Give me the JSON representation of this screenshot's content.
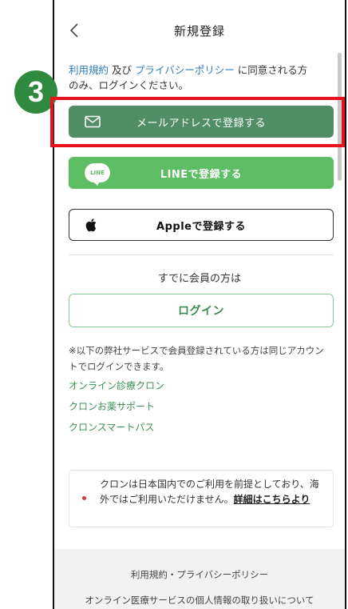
{
  "header": {
    "back_icon": "chevron-left-icon",
    "title": "新規登録"
  },
  "consent": {
    "terms_link": "利用規約",
    "and": " 及び ",
    "privacy_link": "プライバシーポリシー",
    "text": " に同意される方のみ、ログインください。"
  },
  "buttons": {
    "email": {
      "icon": "mail-icon",
      "label": "メールアドレスで登録する"
    },
    "line": {
      "icon": "line-logo-icon",
      "badge": "LINE",
      "label": "LINEで登録する"
    },
    "apple": {
      "icon": "apple-logo-icon",
      "label": "Appleで登録する"
    },
    "login": {
      "label": "ログイン"
    }
  },
  "member_text": "すでに会員の方は",
  "note": "※以下の弊社サービスで会員登録されている方は同じアカウントでログインできます。",
  "services": [
    "オンライン診療クロン",
    "クロンお薬サポート",
    "クロンスマートパス"
  ],
  "notice": {
    "text": "クロンは日本国内でのご利用を前提としており、海外ではご利用いただけません。",
    "link": "詳細はこちらより"
  },
  "footer": {
    "links": [
      "利用規約・プライバシーポリシー",
      "オンライン医療サービスの個人情報の取り扱いについて"
    ]
  },
  "annotation": {
    "step": "3",
    "colors": {
      "badge": "#2f8a3f",
      "highlight": "#e8121c"
    }
  },
  "colors": {
    "email_button": "#4f8f63",
    "line_button": "#5dbd63",
    "link": "#2e7bb8",
    "service_link": "#3d8f55"
  }
}
